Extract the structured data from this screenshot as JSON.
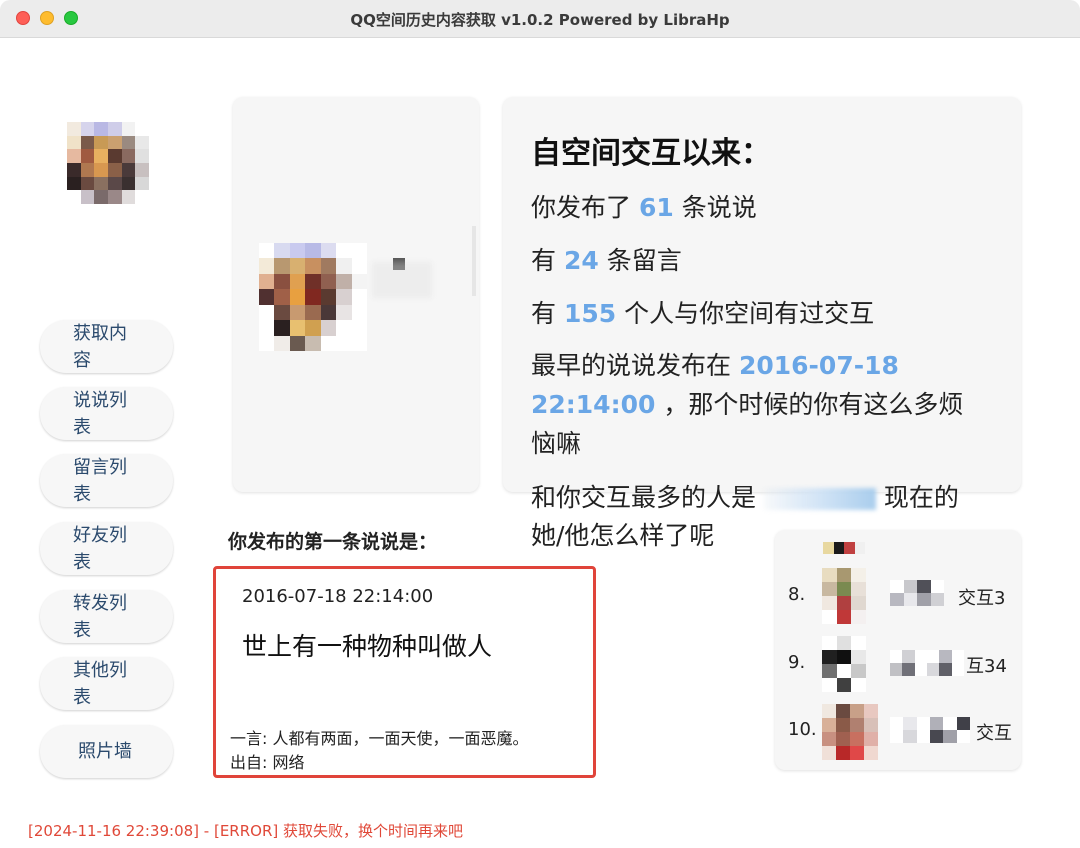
{
  "window": {
    "title": "QQ空间历史内容获取 v1.0.2 Powered by LibraHp"
  },
  "sidebar": {
    "items": [
      {
        "label": "获取内容"
      },
      {
        "label": "说说列表"
      },
      {
        "label": "留言列表"
      },
      {
        "label": "好友列表"
      },
      {
        "label": "转发列表"
      },
      {
        "label": "其他列表"
      },
      {
        "label": "照片墙"
      }
    ]
  },
  "summary": {
    "headline": "自空间交互以来：",
    "line1_pre": "你发布了",
    "posts_count": "61",
    "line1_post": "条说说",
    "line2_pre": "有",
    "messages_count": "24",
    "line2_post": "条留言",
    "line3_pre": "有",
    "people_count": "155",
    "line3_post": "个人与你空间有过交互",
    "line4_pre": "最早的说说发布在",
    "earliest_date": "2016-07-18",
    "earliest_time": "22:14:00",
    "line4_post": "，那个时候的你有这么多烦",
    "line4_tail": "恼嘛",
    "line5_pre": "和你交互最多的人是",
    "line5_post": "现在的",
    "line5_tail": "她/他怎么样了呢"
  },
  "first_post": {
    "label": "你发布的第一条说说是：",
    "time": "2016-07-18 22:14:00",
    "text": "世上有一种物种叫做人",
    "quote": "一言: 人都有两面，一面天使，一面恶魔。",
    "source": "出自: 网络"
  },
  "ranking": {
    "rows": [
      {
        "rank": "8.",
        "tail": "交互3"
      },
      {
        "rank": "9.",
        "tail": "互34"
      },
      {
        "rank": "10.",
        "tail": "交互"
      }
    ]
  },
  "status": {
    "message": "[2024-11-16 22:39:08] - [ERROR] 获取失败，换个时间再来吧"
  }
}
